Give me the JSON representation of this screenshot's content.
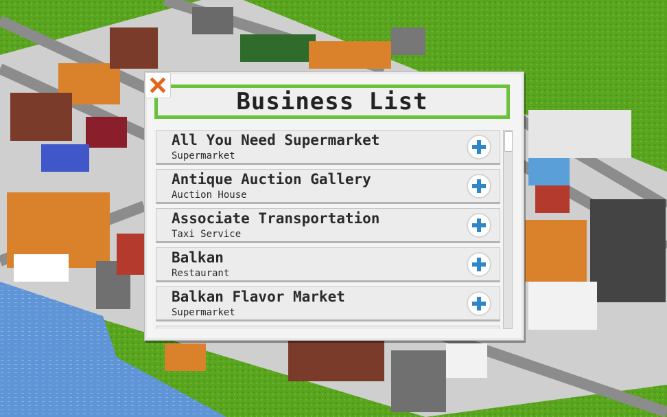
{
  "dialog": {
    "title": "Business List",
    "close_icon": "close-x-icon",
    "accent_color": "#6ac23b",
    "close_color": "#e5641c",
    "row_action_icon": "plus-icon",
    "row_action_color": "#2f86c8"
  },
  "businesses": [
    {
      "name": "All You Need Supermarket",
      "type": "Supermarket"
    },
    {
      "name": "Antique Auction Gallery",
      "type": "Auction House"
    },
    {
      "name": "Associate Transportation",
      "type": "Taxi Service"
    },
    {
      "name": "Balkan",
      "type": "Restaurant"
    },
    {
      "name": "Balkan Flavor Market",
      "type": "Supermarket"
    }
  ],
  "scene": {
    "grass_color": "#5aa51f",
    "road_color": "#9a9a9a",
    "water_color": "#5f95d6"
  }
}
